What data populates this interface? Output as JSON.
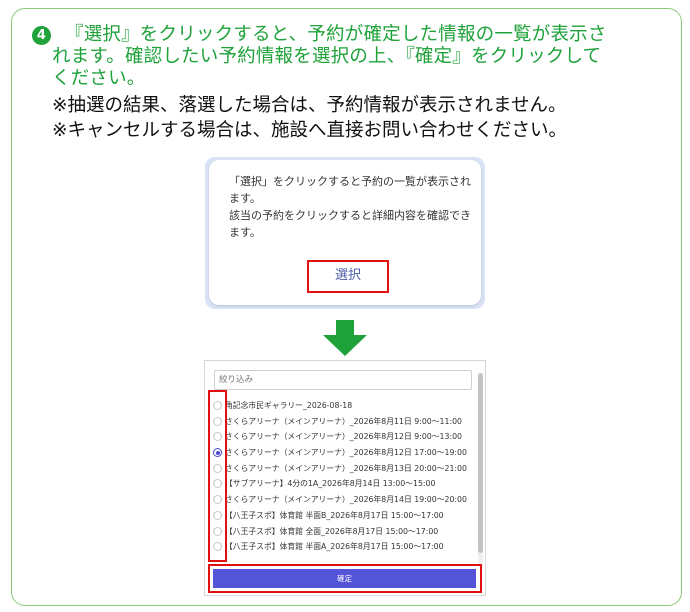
{
  "instruction": {
    "step_number": "4",
    "line1": "『選択』をクリックすると、予約が確定した情報の一覧が表示さ",
    "line2": "れます。確認したい予約情報を選択の上、『確定』をクリックして",
    "line3": "ください。",
    "note1": "※抽選の結果、落選した場合は、予約情報が表示されません。",
    "note2": "※キャンセルする場合は、施設へ直接お問い合わせください。"
  },
  "select_panel": {
    "text1": "「選択」をクリックすると予約の一覧が表示されます。",
    "text2": "該当の予約をクリックすると詳細内容を確認できます。",
    "button_label": "選択"
  },
  "reservation_list": {
    "filter_placeholder": "絞り込み",
    "selected_index": 3,
    "items": [
      "角記念市民ギャラリー_2026-08-18",
      "さくらアリーナ（メインアリーナ）_2026年8月11日 9:00～11:00",
      "さくらアリーナ（メインアリーナ）_2026年8月12日 9:00～13:00",
      "さくらアリーナ（メインアリーナ）_2026年8月12日 17:00～19:00",
      "さくらアリーナ（メインアリーナ）_2026年8月13日 20:00～21:00",
      "【サブアリーナ】4分の1A_2026年8月14日 13:00～15:00",
      "さくらアリーナ（メインアリーナ）_2026年8月14日 19:00～20:00",
      "【八王子スポ】体育館 半面B_2026年8月17日 15:00～17:00",
      "【八王子スポ】体育館 全面_2026年8月17日 15:00～17:00",
      "【八王子スポ】体育館 半面A_2026年8月17日 15:00～17:00"
    ],
    "confirm_label": "確定"
  },
  "colors": {
    "accent_green": "#1fa23a",
    "highlight_red": "#e01010",
    "confirm_button": "#5454d8"
  }
}
